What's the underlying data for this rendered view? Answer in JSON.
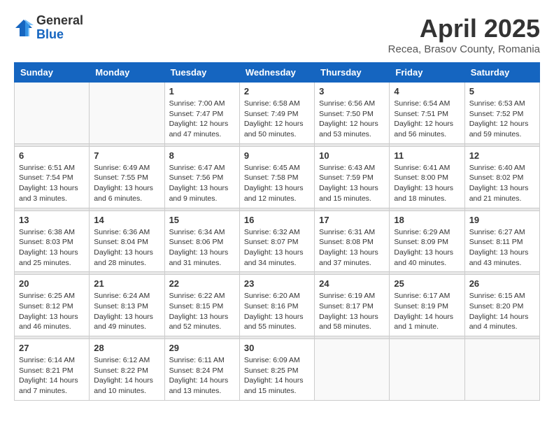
{
  "logo": {
    "general": "General",
    "blue": "Blue"
  },
  "title": "April 2025",
  "location": "Recea, Brasov County, Romania",
  "days_of_week": [
    "Sunday",
    "Monday",
    "Tuesday",
    "Wednesday",
    "Thursday",
    "Friday",
    "Saturday"
  ],
  "weeks": [
    [
      {
        "day": "",
        "info": ""
      },
      {
        "day": "",
        "info": ""
      },
      {
        "day": "1",
        "info": "Sunrise: 7:00 AM\nSunset: 7:47 PM\nDaylight: 12 hours and 47 minutes."
      },
      {
        "day": "2",
        "info": "Sunrise: 6:58 AM\nSunset: 7:49 PM\nDaylight: 12 hours and 50 minutes."
      },
      {
        "day": "3",
        "info": "Sunrise: 6:56 AM\nSunset: 7:50 PM\nDaylight: 12 hours and 53 minutes."
      },
      {
        "day": "4",
        "info": "Sunrise: 6:54 AM\nSunset: 7:51 PM\nDaylight: 12 hours and 56 minutes."
      },
      {
        "day": "5",
        "info": "Sunrise: 6:53 AM\nSunset: 7:52 PM\nDaylight: 12 hours and 59 minutes."
      }
    ],
    [
      {
        "day": "6",
        "info": "Sunrise: 6:51 AM\nSunset: 7:54 PM\nDaylight: 13 hours and 3 minutes."
      },
      {
        "day": "7",
        "info": "Sunrise: 6:49 AM\nSunset: 7:55 PM\nDaylight: 13 hours and 6 minutes."
      },
      {
        "day": "8",
        "info": "Sunrise: 6:47 AM\nSunset: 7:56 PM\nDaylight: 13 hours and 9 minutes."
      },
      {
        "day": "9",
        "info": "Sunrise: 6:45 AM\nSunset: 7:58 PM\nDaylight: 13 hours and 12 minutes."
      },
      {
        "day": "10",
        "info": "Sunrise: 6:43 AM\nSunset: 7:59 PM\nDaylight: 13 hours and 15 minutes."
      },
      {
        "day": "11",
        "info": "Sunrise: 6:41 AM\nSunset: 8:00 PM\nDaylight: 13 hours and 18 minutes."
      },
      {
        "day": "12",
        "info": "Sunrise: 6:40 AM\nSunset: 8:02 PM\nDaylight: 13 hours and 21 minutes."
      }
    ],
    [
      {
        "day": "13",
        "info": "Sunrise: 6:38 AM\nSunset: 8:03 PM\nDaylight: 13 hours and 25 minutes."
      },
      {
        "day": "14",
        "info": "Sunrise: 6:36 AM\nSunset: 8:04 PM\nDaylight: 13 hours and 28 minutes."
      },
      {
        "day": "15",
        "info": "Sunrise: 6:34 AM\nSunset: 8:06 PM\nDaylight: 13 hours and 31 minutes."
      },
      {
        "day": "16",
        "info": "Sunrise: 6:32 AM\nSunset: 8:07 PM\nDaylight: 13 hours and 34 minutes."
      },
      {
        "day": "17",
        "info": "Sunrise: 6:31 AM\nSunset: 8:08 PM\nDaylight: 13 hours and 37 minutes."
      },
      {
        "day": "18",
        "info": "Sunrise: 6:29 AM\nSunset: 8:09 PM\nDaylight: 13 hours and 40 minutes."
      },
      {
        "day": "19",
        "info": "Sunrise: 6:27 AM\nSunset: 8:11 PM\nDaylight: 13 hours and 43 minutes."
      }
    ],
    [
      {
        "day": "20",
        "info": "Sunrise: 6:25 AM\nSunset: 8:12 PM\nDaylight: 13 hours and 46 minutes."
      },
      {
        "day": "21",
        "info": "Sunrise: 6:24 AM\nSunset: 8:13 PM\nDaylight: 13 hours and 49 minutes."
      },
      {
        "day": "22",
        "info": "Sunrise: 6:22 AM\nSunset: 8:15 PM\nDaylight: 13 hours and 52 minutes."
      },
      {
        "day": "23",
        "info": "Sunrise: 6:20 AM\nSunset: 8:16 PM\nDaylight: 13 hours and 55 minutes."
      },
      {
        "day": "24",
        "info": "Sunrise: 6:19 AM\nSunset: 8:17 PM\nDaylight: 13 hours and 58 minutes."
      },
      {
        "day": "25",
        "info": "Sunrise: 6:17 AM\nSunset: 8:19 PM\nDaylight: 14 hours and 1 minute."
      },
      {
        "day": "26",
        "info": "Sunrise: 6:15 AM\nSunset: 8:20 PM\nDaylight: 14 hours and 4 minutes."
      }
    ],
    [
      {
        "day": "27",
        "info": "Sunrise: 6:14 AM\nSunset: 8:21 PM\nDaylight: 14 hours and 7 minutes."
      },
      {
        "day": "28",
        "info": "Sunrise: 6:12 AM\nSunset: 8:22 PM\nDaylight: 14 hours and 10 minutes."
      },
      {
        "day": "29",
        "info": "Sunrise: 6:11 AM\nSunset: 8:24 PM\nDaylight: 14 hours and 13 minutes."
      },
      {
        "day": "30",
        "info": "Sunrise: 6:09 AM\nSunset: 8:25 PM\nDaylight: 14 hours and 15 minutes."
      },
      {
        "day": "",
        "info": ""
      },
      {
        "day": "",
        "info": ""
      },
      {
        "day": "",
        "info": ""
      }
    ]
  ]
}
